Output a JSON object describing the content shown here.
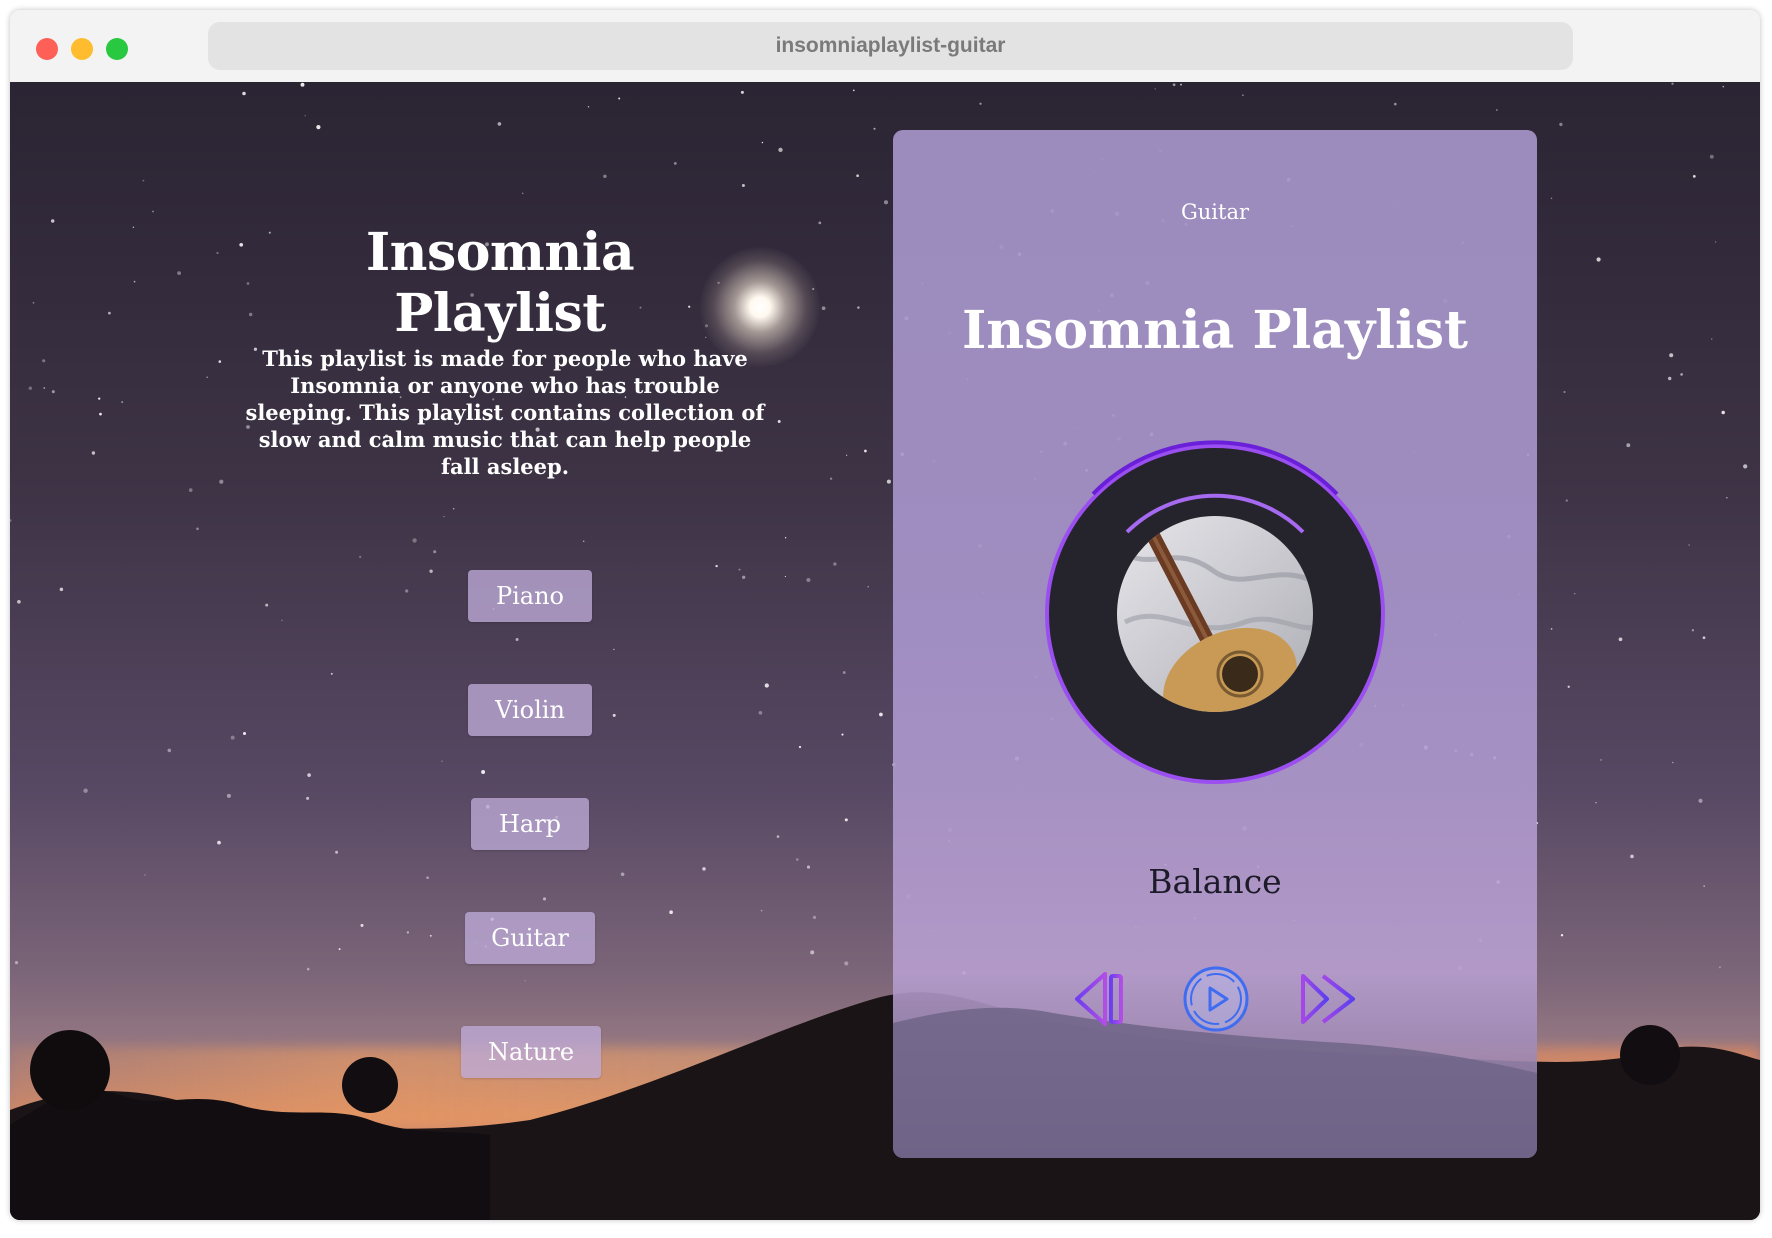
{
  "browser": {
    "url": "insomniaplaylist-guitar"
  },
  "intro": {
    "title": "Insomnia Playlist",
    "description": "This playlist is made for people who have Insomnia or anyone who has trouble sleeping. This playlist contains collection of slow and calm music that can help people fall asleep."
  },
  "categories": [
    {
      "label": "Piano"
    },
    {
      "label": "Violin"
    },
    {
      "label": "Harp"
    },
    {
      "label": "Guitar"
    },
    {
      "label": "Nature"
    }
  ],
  "player": {
    "category": "Guitar",
    "title": "Insomnia Playlist",
    "track": "Balance",
    "controls": {
      "previous_icon": "skip-previous-icon",
      "play_icon": "play-icon",
      "next_icon": "skip-next-icon"
    },
    "accent_color": "#8b47e8"
  }
}
